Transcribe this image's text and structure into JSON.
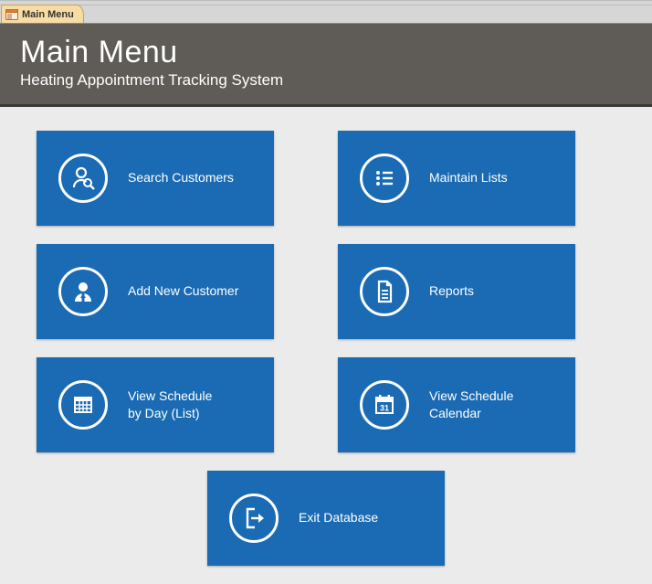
{
  "tab": {
    "label": "Main Menu"
  },
  "header": {
    "title": "Main Menu",
    "subtitle": "Heating Appointment Tracking System"
  },
  "tiles": {
    "search_customers": "Search Customers",
    "add_new_customer": "Add New Customer",
    "view_schedule_list": "View Schedule\nby Day (List)",
    "maintain_lists": "Maintain Lists",
    "reports": "Reports",
    "view_schedule_calendar": "View Schedule\nCalendar",
    "exit_database": "Exit Database"
  }
}
